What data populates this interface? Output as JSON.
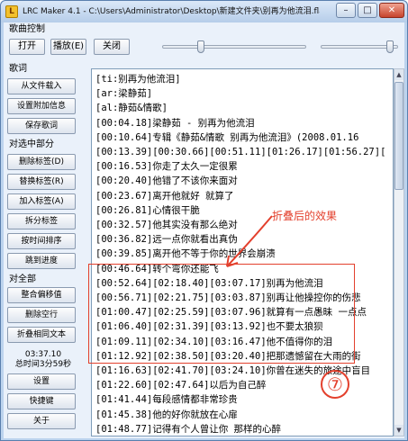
{
  "window": {
    "title": "LRC Maker 4.1 - C:\\Users\\Administrator\\Desktop\\新建文件夹\\别再为他流泪.flac",
    "app_icon_text": "L",
    "minimize": "–",
    "maximize": "□",
    "close": "✕"
  },
  "playback": {
    "group_label": "歌曲控制",
    "open_label": "打开",
    "pause_label": "播放(E)",
    "close_label": "关闭",
    "progress": 0.27,
    "volume": 0.9
  },
  "sidebar": {
    "lyrics_group": "歌词",
    "lyrics_buttons": [
      "从文件载入",
      "设置附加信息",
      "保存歌词"
    ],
    "selection_group": "对选中部分",
    "selection_buttons": [
      "删除标签(D)",
      "替换标签(R)",
      "加入标签(A)",
      "拆分标签",
      "按时间排序",
      "跳到进度"
    ],
    "all_group": "对全部",
    "all_buttons": [
      "整合偏移值",
      "删除空行",
      "折叠相同文本"
    ],
    "current_time": "03:37.10",
    "total_time": "总时间3分59秒",
    "settings_label": "设置",
    "shortcuts_label": "快捷键",
    "about_label": "关于"
  },
  "editor": {
    "lines": [
      "[ti:别再为他流泪]",
      "[ar:梁静茹]",
      "[al:静茹&情歌]",
      "[00:04.18]梁静茹 - 别再为他流泪",
      "[00:10.64]专辑《静茹&情歌 别再为他流泪》(2008.01.16",
      "[00:13.39][00:30.66][00:51.11][01:26.17][01:56.27][",
      "[00:16.53]你走了太久一定很累",
      "[00:20.40]他错了不该你来面对",
      "[00:23.67]离开他就好 就算了",
      "[00:26.81]心情很干脆",
      "[00:32.57]他其实没有那么绝对",
      "[00:36.82]远一点你就看出真伪",
      "[00:39.85]离开他不等于你的世界会崩溃",
      "[00:46.64]转个弯你还能飞",
      "[00:52.64][02:18.40][03:07.17]别再为他流泪",
      "[00:56.71][02:21.75][03:03.87]别再让他操控你的伤悲",
      "[01:00.47][02:25.59][03:07.96]就算有一点愚昧 一点点",
      "[01:06.40][02:31.39][03:13.92]也不要太狼狈",
      "[01:09.11][02:34.10][03:16.47]他不值得你的泪",
      "[01:12.92][02:38.50][03:20.40]把那遗憾留在大雨的街",
      "[01:16.63][02:41.70][03:24.10]你曾在迷失的旅途中盲目",
      "[01:22.60][02:47.64]以后为自己醉",
      "[01:41.44]每段感情都非常珍贵",
      "[01:45.38]他的好你就放在心扉",
      "[01:48.77]记得有个人曾让你 那样的心醉"
    ]
  },
  "annotation": {
    "fold_label": "折叠后的效果",
    "step_number": "⑦"
  },
  "colors": {
    "annotation_red": "#e3402d",
    "window_frame": "#bcd3ee"
  }
}
